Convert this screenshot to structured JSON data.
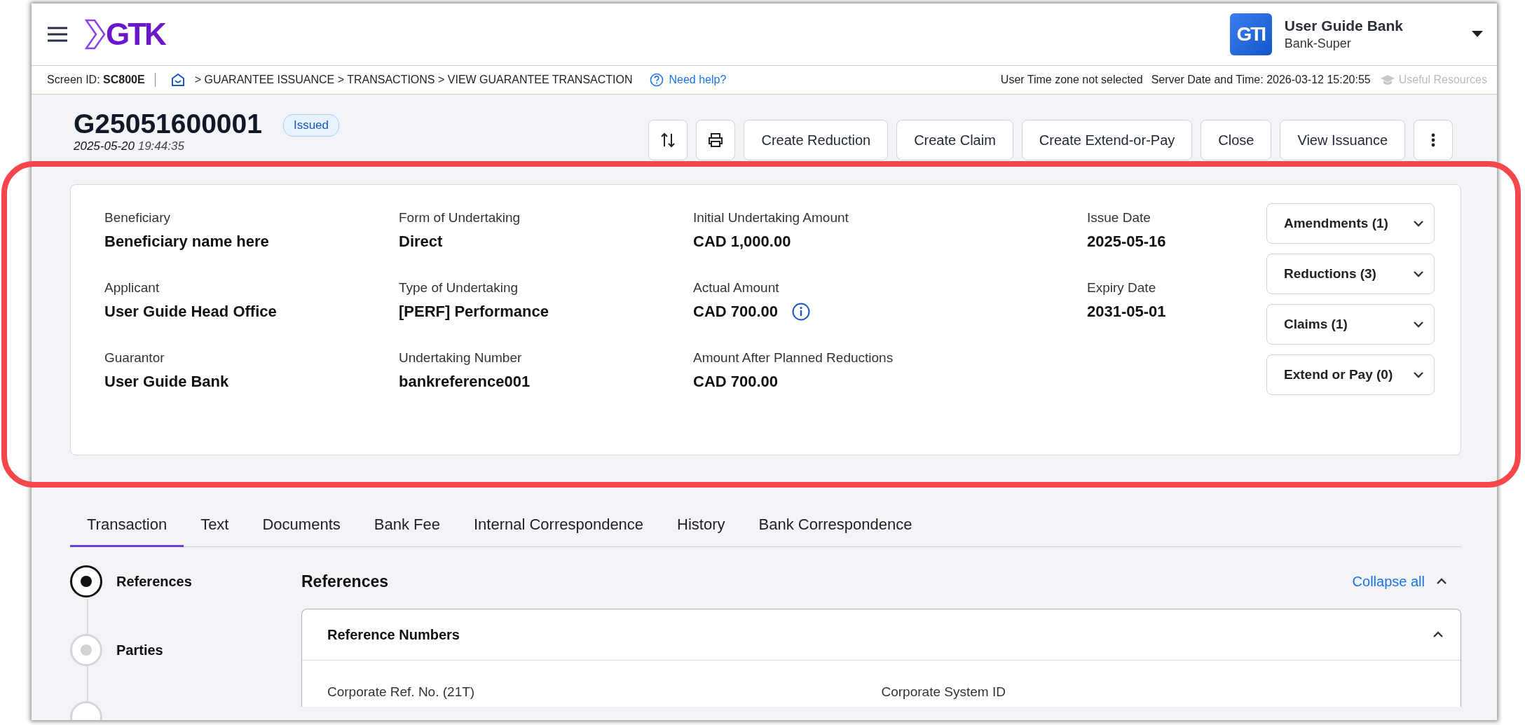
{
  "header": {
    "logo_text": "GTK",
    "bank_logo_text": "GTI",
    "bank_name": "User Guide Bank",
    "user_role": "Bank-Super"
  },
  "breadcrumb_bar": {
    "screen_id_label": "Screen ID:",
    "screen_id": "SC800E",
    "path": ">  GUARANTEE ISSUANCE > TRANSACTIONS > VIEW GUARANTEE TRANSACTION",
    "help": "Need help?",
    "timezone": "User Time zone not selected",
    "server_time": "Server Date and Time: 2026-03-12 15:20:55",
    "resources": "Useful Resources",
    "resources_disabled": true
  },
  "transaction": {
    "id": "G25051600001",
    "status": "Issued",
    "date": "2025-05-20",
    "time": "19:44:35"
  },
  "actions": [
    {
      "kind": "sort"
    },
    {
      "kind": "print"
    },
    {
      "kind": "text",
      "label": "Create Reduction"
    },
    {
      "kind": "text",
      "label": "Create Claim"
    },
    {
      "kind": "text",
      "label": "Create Extend-or-Pay"
    },
    {
      "kind": "text",
      "label": "Close"
    },
    {
      "kind": "text",
      "label": "View Issuance"
    },
    {
      "kind": "more"
    }
  ],
  "summary": {
    "columns": [
      [
        {
          "label": "Beneficiary",
          "value": "Beneficiary name here",
          "info": false
        },
        {
          "label": "Applicant",
          "value": "User Guide Head Office",
          "info": false
        },
        {
          "label": "Guarantor",
          "value": "User Guide Bank",
          "info": false
        }
      ],
      [
        {
          "label": "Form of Undertaking",
          "value": "Direct",
          "info": false
        },
        {
          "label": "Type of Undertaking",
          "value": "[PERF] Performance",
          "info": false
        },
        {
          "label": "Undertaking Number",
          "value": "bankreference001",
          "info": false
        }
      ],
      [
        {
          "label": "Initial Undertaking Amount",
          "value": "CAD 1,000.00",
          "info": false
        },
        {
          "label": "Actual Amount",
          "value": "CAD 700.00",
          "info": true
        },
        {
          "label": "Amount After Planned Reductions",
          "value": "CAD 700.00",
          "info": false
        }
      ],
      [
        {
          "label": "Issue Date",
          "value": "2025-05-16",
          "info": false
        },
        {
          "label": "Expiry Date",
          "value": "2031-05-01",
          "info": false
        }
      ]
    ],
    "dropdowns": [
      {
        "label": "Amendments (1)"
      },
      {
        "label": "Reductions (3)"
      },
      {
        "label": "Claims (1)"
      },
      {
        "label": "Extend or Pay (0)"
      }
    ],
    "highlighted": true
  },
  "tabs": [
    {
      "label": "Transaction",
      "selected": true
    },
    {
      "label": "Text",
      "selected": false
    },
    {
      "label": "Documents",
      "selected": false
    },
    {
      "label": "Bank Fee",
      "selected": false
    },
    {
      "label": "Internal Correspondence",
      "selected": false
    },
    {
      "label": "History",
      "selected": false
    },
    {
      "label": "Bank Correspondence",
      "selected": false
    }
  ],
  "steps": [
    {
      "label": "References",
      "selected": true
    },
    {
      "label": "Parties",
      "selected": false
    }
  ],
  "section": {
    "title": "References",
    "collapse_all": "Collapse all",
    "panel": {
      "title": "Reference Numbers",
      "expanded": true,
      "fields": [
        "Corporate Ref. No. (21T)",
        "Corporate System ID"
      ]
    }
  }
}
